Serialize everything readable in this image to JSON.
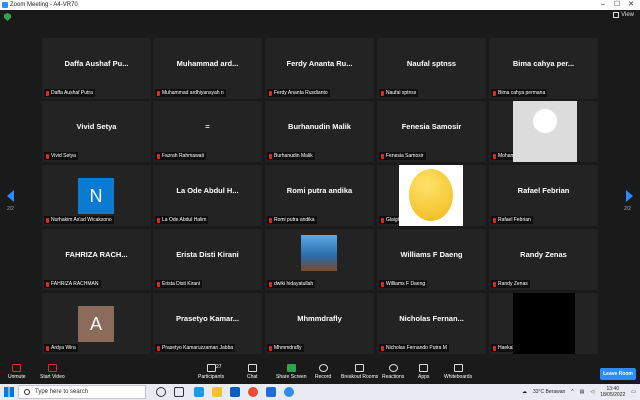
{
  "window": {
    "title": "Zoom Meeting - A4-VR70",
    "view_label": "View"
  },
  "pagination": {
    "left": "2/2",
    "right": "2/2"
  },
  "tiles": [
    {
      "name": "Daffa  Aushaf Pu...",
      "label": "Daffa Aushaf Putra"
    },
    {
      "name": "Muhammad  ard...",
      "label": "Muhammad ardhiyansyah n"
    },
    {
      "name": "Ferdy  Ananta  Ru...",
      "label": "Ferdy Ananta Rusdianto"
    },
    {
      "name": "Naufal  sptnss",
      "label": "Naufal sptnss"
    },
    {
      "name": "Bima  cahya  per...",
      "label": "Bima cahya permana"
    },
    {
      "name": "Vivid  Setya",
      "label": "Vivid Setya"
    },
    {
      "name": "=",
      "label": "Fazrah Rahmawati"
    },
    {
      "name": "Burhanudin  Malik",
      "label": "Burhanudin Malik"
    },
    {
      "name": "Fenesia  Samosir",
      "label": "Fenesia Samosir"
    },
    {
      "name": "",
      "label": "Mohammad Sanusi Ramz"
    },
    {
      "name": "",
      "label": "Nurhakim As'ad Wicaksono",
      "avatar": "N"
    },
    {
      "name": "La  Ode  Abdul  H...",
      "label": "La Ode Abdul Halim"
    },
    {
      "name": "Romi  putra  andika",
      "label": "Romi putra andika"
    },
    {
      "name": "",
      "label": "Glaighan Dipranta"
    },
    {
      "name": "Rafael  Febrian",
      "label": "Rafael Febrian"
    },
    {
      "name": "FAHRIZA  RACH...",
      "label": "FAHRIZA RACHMAN"
    },
    {
      "name": "Erista  Disti  Kirani",
      "label": "Erista Disti Kirani"
    },
    {
      "name": "",
      "label": "dwiki hidayatullah"
    },
    {
      "name": "Williams  F  Daeng",
      "label": "Williams F Daeng"
    },
    {
      "name": "Randy  Zenas",
      "label": "Randy Zenas"
    },
    {
      "name": "",
      "label": "Ardya Wira",
      "avatar": "A"
    },
    {
      "name": "Prasetyo  Kamar...",
      "label": "Prasetyo Kamaruzzaman Jabba"
    },
    {
      "name": "Mhmmdrafly",
      "label": "Mhmmdrafly"
    },
    {
      "name": "Nicholas  Fernan...",
      "label": "Nicholas Fernando Putra M"
    },
    {
      "name": "",
      "label": "Haekal"
    }
  ],
  "toolbar": {
    "unmute": "Unmute",
    "start_video": "Start Video",
    "participants": "Participants",
    "participants_count": "27",
    "chat": "Chat",
    "share_screen": "Share Screen",
    "record": "Record",
    "breakout": "Breakout Rooms",
    "reactions": "Reactions",
    "apps": "Apps",
    "whiteboards": "Whiteboards",
    "leave": "Leave Room"
  },
  "taskbar": {
    "search_placeholder": "Type here to search",
    "weather": "33°C  Berawan",
    "time": "13:40",
    "date": "18/05/2022"
  },
  "colors": {
    "accent": "#2d8cff",
    "share_green": "#2ea44f",
    "muted_red": "#e02828"
  }
}
